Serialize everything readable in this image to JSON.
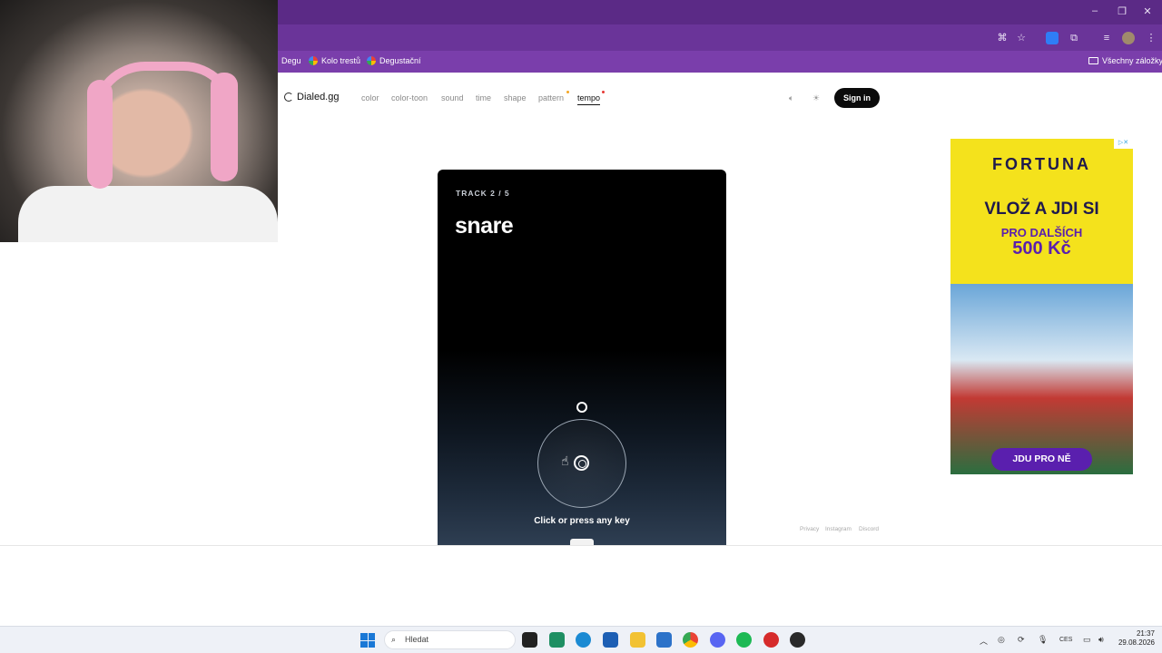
{
  "browser": {
    "bookmarks": [
      {
        "label": "Degu"
      },
      {
        "label": "Kolo trestů"
      },
      {
        "label": "Degustační"
      }
    ],
    "all_bookmarks_label": "Všechny záložky",
    "icons": [
      "translate-icon",
      "star-icon",
      "extension-icon",
      "puzzle-icon",
      "media-icon",
      "profile-icon",
      "menu-icon"
    ]
  },
  "site": {
    "logo": "Dialed.gg",
    "nav": [
      {
        "label": "color"
      },
      {
        "label": "color-toon"
      },
      {
        "label": "sound"
      },
      {
        "label": "time"
      },
      {
        "label": "shape"
      },
      {
        "label": "pattern"
      },
      {
        "label": "tempo"
      }
    ],
    "active_nav": "tempo",
    "dot_colors": {
      "pattern": "#f5a623",
      "tempo": "#e53935"
    },
    "sign_in": "Sign in",
    "footer": [
      "Privacy",
      "Instagram",
      "Discord"
    ]
  },
  "game": {
    "track_label": "TRACK 2 / 5",
    "track_title": "snare",
    "hint": "Click or press any key"
  },
  "ad": {
    "brand": "FORTUNA",
    "headline": "VLOŽ A JDI SI",
    "sub": "PRO DALŠÍCH",
    "amount": "500 Kč",
    "cta": "JDU PRO NĚ",
    "colors": {
      "bg": "#f4e21c",
      "primary": "#5a1fae",
      "dark": "#1f1a4d"
    }
  },
  "taskbar": {
    "search_placeholder": "Hledat",
    "language": "CES",
    "time": "21:37",
    "date": "29.08.2026"
  }
}
